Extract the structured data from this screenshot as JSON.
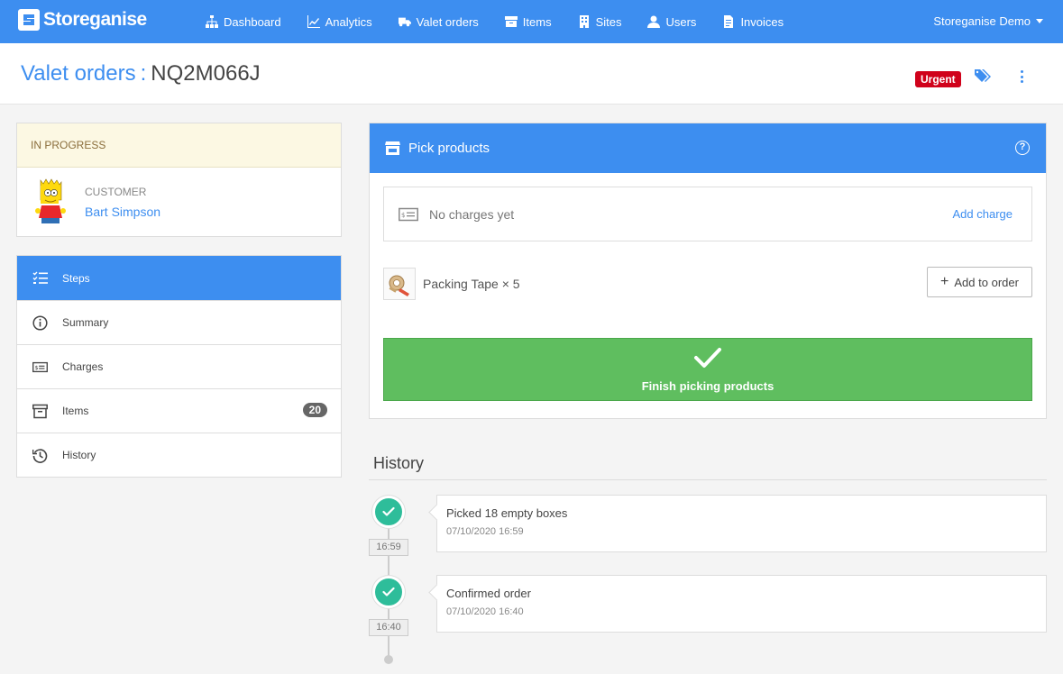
{
  "nav": {
    "brand": "Storeganise",
    "items": [
      {
        "label": "Dashboard",
        "icon": "sitemap-icon"
      },
      {
        "label": "Analytics",
        "icon": "line-chart-icon"
      },
      {
        "label": "Valet orders",
        "icon": "truck-icon"
      },
      {
        "label": "Items",
        "icon": "archive-icon"
      },
      {
        "label": "Sites",
        "icon": "building-icon"
      },
      {
        "label": "Users",
        "icon": "user-icon"
      },
      {
        "label": "Invoices",
        "icon": "file-invoice-icon"
      }
    ],
    "account": "Storeganise Demo"
  },
  "header": {
    "crumb": "Valet orders",
    "separator": ":",
    "order_code": "NQ2M066J",
    "badge": "Urgent"
  },
  "status": {
    "label": "IN PROGRESS",
    "customer_label": "CUSTOMER",
    "customer_name": "Bart Simpson"
  },
  "menu": [
    {
      "label": "Steps",
      "icon": "checklist-icon",
      "active": true
    },
    {
      "label": "Summary",
      "icon": "info-icon"
    },
    {
      "label": "Charges",
      "icon": "money-bill-icon"
    },
    {
      "label": "Items",
      "icon": "archive-icon",
      "badge": "20"
    },
    {
      "label": "History",
      "icon": "history-icon"
    }
  ],
  "panel": {
    "title": "Pick products",
    "help": "?",
    "charges_text": "No charges yet",
    "add_charge": "Add charge",
    "product": "Packing Tape × 5",
    "add_to_order": "Add to order",
    "finish": "Finish picking products"
  },
  "history": {
    "title": "History",
    "events": [
      {
        "time": "16:59",
        "title": "Picked 18 empty boxes",
        "date": "07/10/2020 16:59"
      },
      {
        "time": "16:40",
        "title": "Confirmed order",
        "date": "07/10/2020 16:40"
      }
    ]
  },
  "colors": {
    "primary": "#3d8ef0",
    "urgent": "#d0021b",
    "success": "#5fbe5f",
    "timeline": "#2ebd9a"
  }
}
